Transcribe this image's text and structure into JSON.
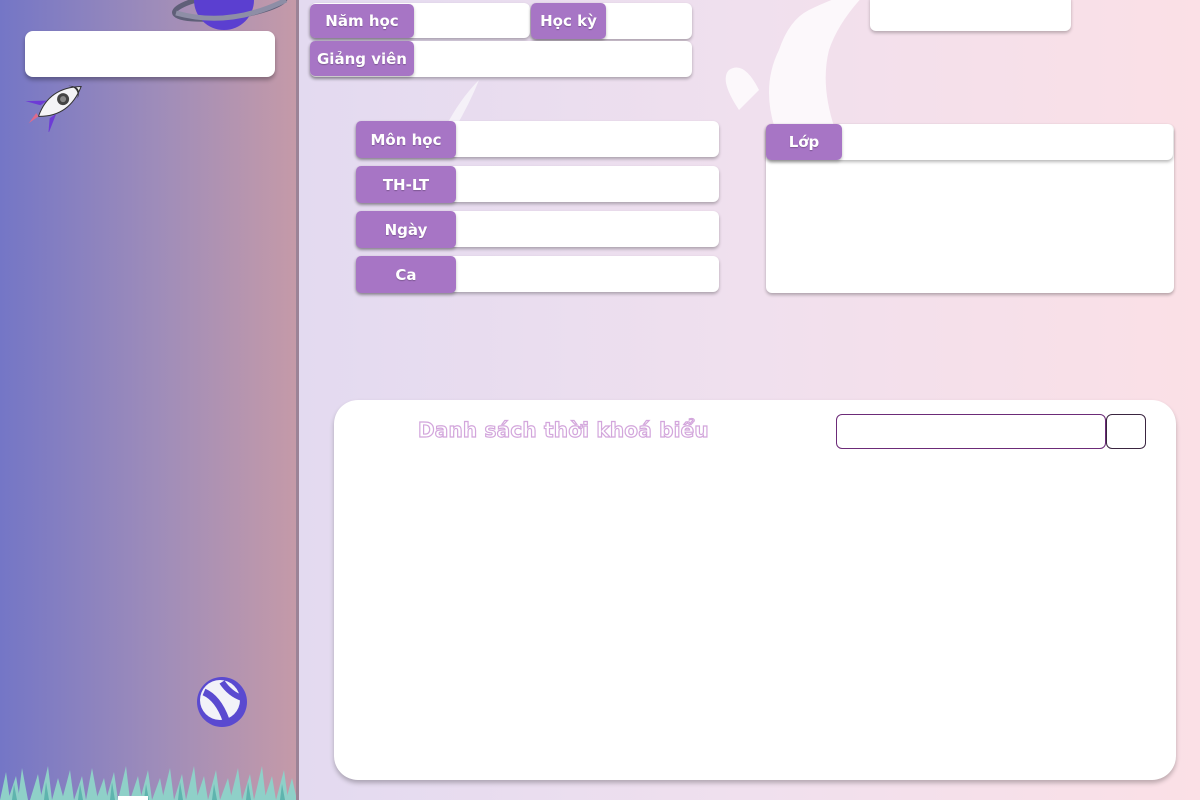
{
  "filters": {
    "nam_hoc_label": "Năm học",
    "hoc_ky_label": "Học kỳ",
    "giang_vien_label": "Giảng viên",
    "mon_hoc_label": "Môn học",
    "th_lt_label": "TH-LT",
    "ngay_label": "Ngày",
    "ca_label": "Ca",
    "lop_label": "Lớp"
  },
  "panel": {
    "title": "Danh sách thời khoá biểu",
    "search_placeholder": ""
  },
  "colors": {
    "tag": "#a775c5",
    "sidebar_start": "#7476c6",
    "sidebar_end": "#c59aa8",
    "search_border": "#6c2b78"
  },
  "icons": [
    "planet-icon",
    "rocket-icon",
    "ball-icon",
    "grass-decoration",
    "bunny-decoration"
  ]
}
